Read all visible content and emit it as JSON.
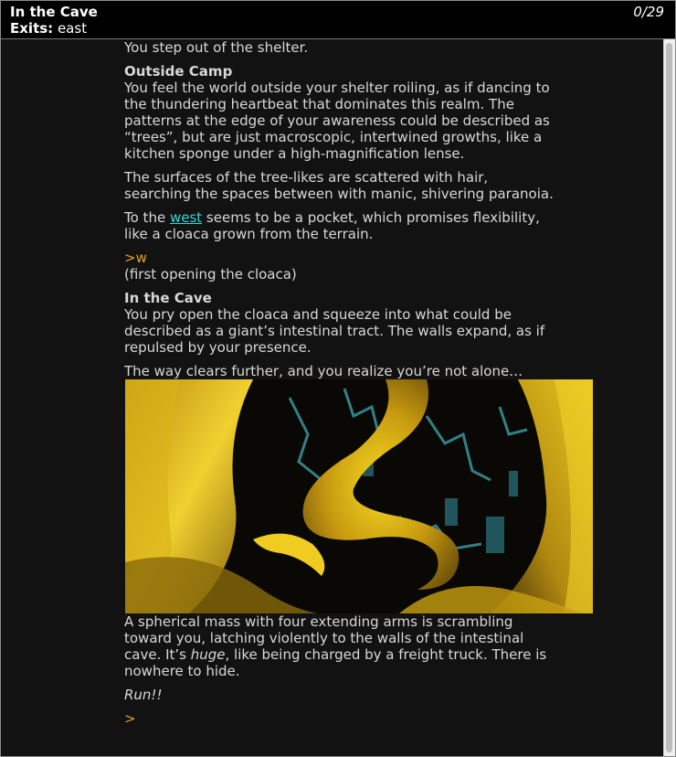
{
  "status": {
    "title": "In the Cave",
    "exits_label": "Exits:",
    "exits_value": "east",
    "score": "0/29"
  },
  "story": {
    "line_shelter": "You step out of the shelter.",
    "camp_heading": "Outside Camp",
    "camp_para1": "You feel the world outside your shelter roiling, as if dancing to the thundering heartbeat that dominates this realm.  The patterns at the edge of your awareness could be described as “trees”, but are just macroscopic, intertwined growths, like a kitchen sponge under a high-magnification lense.",
    "camp_para2": "The surfaces of the tree-likes are scattered with hair, searching the spaces between with manic, shivering paranoia.",
    "camp_para3_pre": "To the ",
    "camp_para3_link": "west",
    "camp_para3_post": " seems to be a pocket, which promises flexibility, like a cloaca grown from the terrain.",
    "command1": ">w",
    "command1_note": "(first opening the cloaca)",
    "cave_heading": "In the Cave",
    "cave_para1": "You pry open the cloaca and squeeze into what could be described as a giant’s intestinal tract.  The walls expand, as if repulsed by your presence.",
    "cave_para2": "The way clears further, and you realize you’re not alone…",
    "cave_para3_pre": "A spherical mass with four extending arms is scrambling toward you, latching violently to the walls of the intestinal cave.  It’s ",
    "cave_para3_em": "huge",
    "cave_para3_post": ", like being charged by a freight truck.  There is nowhere to hide.",
    "run_text": "Run!!",
    "prompt": ">"
  },
  "colors": {
    "command": "#e0a020",
    "link": "#30d8d8",
    "text": "#d8d8d8",
    "background": "#121212"
  },
  "scroll_position": 1.0
}
